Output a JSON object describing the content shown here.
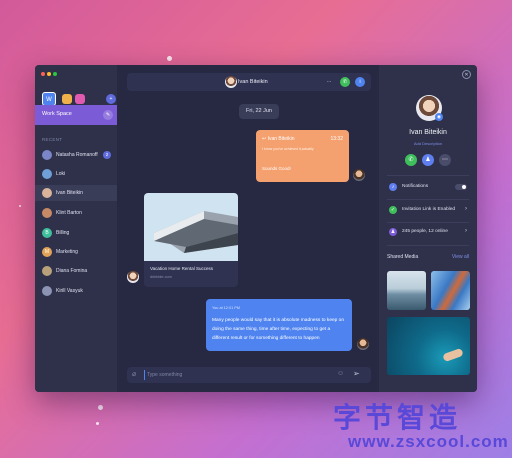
{
  "sidebar": {
    "workspace_initial": "W",
    "workspace_label": "Work Space",
    "recent_label": "RECENT",
    "contacts": [
      {
        "name": "Natasha Romanoff",
        "badge": "2",
        "color": "#7a86c8"
      },
      {
        "name": "Loki",
        "badge": "",
        "color": "#6fa0d8"
      },
      {
        "name": "Ivan Biteikin",
        "badge": "",
        "color": "#d9b49a"
      },
      {
        "name": "Klint Barton",
        "badge": "",
        "color": "#c88a66"
      },
      {
        "name": "Billing",
        "badge": "",
        "color": "#3fbf9c"
      },
      {
        "name": "Marketing",
        "badge": "",
        "color": "#e0a257"
      },
      {
        "name": "Diana Fomina",
        "badge": "",
        "color": "#b8a07a"
      },
      {
        "name": "Kirill Vasyuk",
        "badge": "",
        "color": "#8c93b3"
      }
    ]
  },
  "chat": {
    "header_name": "Ivan Biteikin",
    "date": "Fri, 22 Jun",
    "orange_msg": {
      "title": "Ivan Biteikin",
      "time": "13:32",
      "subtitle": "I know you've achieved it,actually",
      "text": "Sounds Good!"
    },
    "image_card": {
      "caption": "Vacation Home Rental Success",
      "source": "dribbble.com"
    },
    "blue_msg": {
      "time": "You at 12:01 PM",
      "text": "Many people would say that it is absolute madness to keep on doing the same thing, time after time, expecting to get a different result or for something different to happen"
    },
    "input_placeholder": "Type something"
  },
  "profile": {
    "name": "Ivan Biteikin",
    "description": "Add Description",
    "settings": {
      "notifications": "Notifications",
      "invitation": "Invitation Link is Enabled",
      "people": "245 people, 12 online"
    },
    "shared_media_title": "Shared Media",
    "view_all": "View all"
  },
  "watermark": {
    "chinese": "字节智造",
    "url": "www.zsxcool.com"
  }
}
